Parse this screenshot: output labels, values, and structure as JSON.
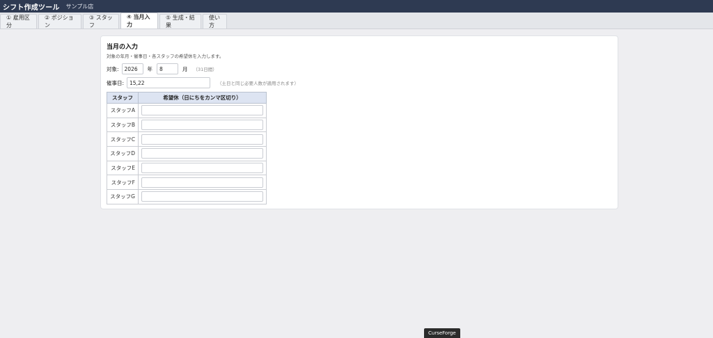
{
  "header": {
    "app_title": "シフト作成ツール",
    "store_name": "サンプル店"
  },
  "tabs": [
    {
      "label": "① 雇用区分"
    },
    {
      "label": "② ポジション"
    },
    {
      "label": "③ スタッフ"
    },
    {
      "label": "④ 当月入力",
      "active": true
    },
    {
      "label": "⑤ 生成・結果"
    },
    {
      "label": "使い方"
    }
  ],
  "section": {
    "title": "当月の入力",
    "description": "対象の年月・催事日・各スタッフの希望休を入力します。"
  },
  "target": {
    "label": "対象:",
    "year_value": "2026",
    "year_unit": "年",
    "month_value": "8",
    "month_unit": "月",
    "days_hint": "（31日間）"
  },
  "event_days": {
    "label": "催事日:",
    "value": "15,22",
    "hint": "（土日と同じ必要人数が適用されます）"
  },
  "staff_table": {
    "headers": [
      "スタッフ",
      "希望休（日にちをカンマ区切り）"
    ],
    "rows": [
      {
        "name": "スタッフA",
        "value": ""
      },
      {
        "name": "スタッフB",
        "value": ""
      },
      {
        "name": "スタッフC",
        "value": ""
      },
      {
        "name": "スタッフD",
        "value": ""
      },
      {
        "name": "スタッフE",
        "value": ""
      },
      {
        "name": "スタッフF",
        "value": ""
      },
      {
        "name": "スタッフG",
        "value": ""
      }
    ]
  },
  "tooltip": {
    "text": "CurseForge"
  }
}
